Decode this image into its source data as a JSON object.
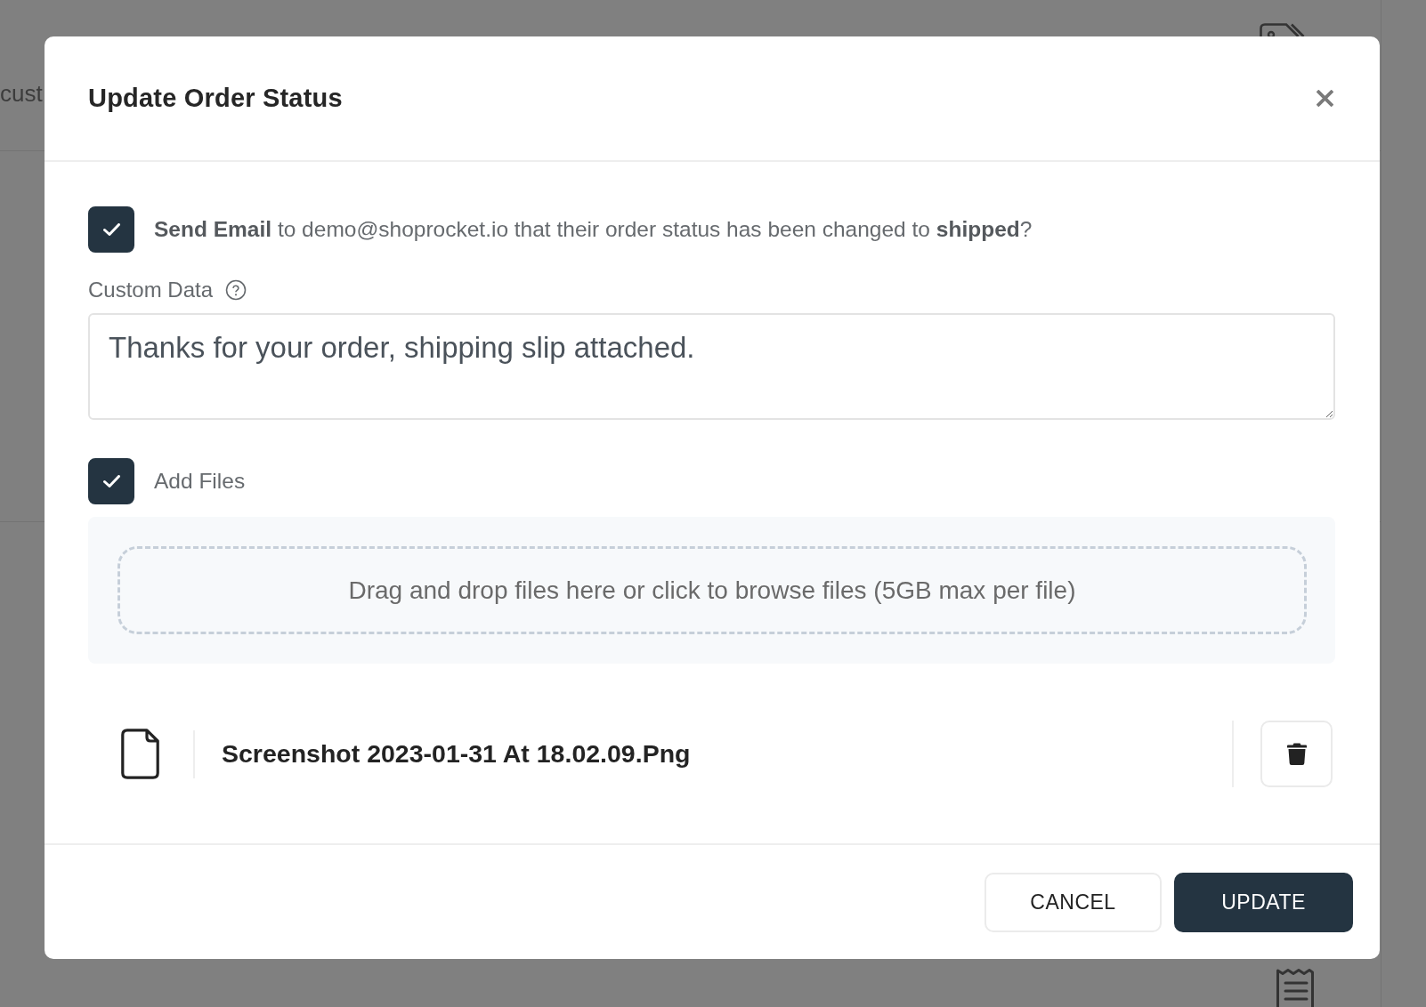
{
  "background_page": {
    "heading_fragment": "cust"
  },
  "dialog": {
    "title": "Update Order Status",
    "send_email": {
      "checked": true,
      "text": "**Send Email** to demo@shoprocket.io that their order status has been changed to **shipped**?"
    },
    "custom_data": {
      "label": "Custom Data",
      "value": "Thanks for your order, shipping slip attached."
    },
    "add_files": {
      "checked": true,
      "label": "Add Files"
    },
    "dropzone": {
      "text": "Drag and drop files here or click to browse files (5GB max per file)"
    },
    "files": [
      {
        "name": "Screenshot 2023-01-31 At 18.02.09.Png"
      }
    ],
    "buttons": [
      {
        "label": "CANCEL",
        "kind": "secondary"
      },
      {
        "label": "UPDATE",
        "kind": "primary"
      }
    ]
  }
}
